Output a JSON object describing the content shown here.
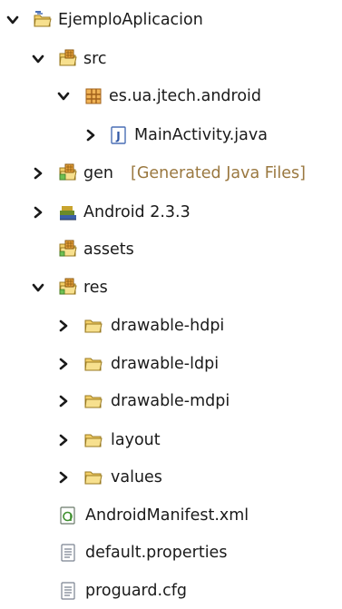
{
  "tree": {
    "project": "EjemploAplicacion",
    "src": "src",
    "package": "es.ua.jtech.android",
    "main_activity": "MainActivity.java",
    "gen": "gen",
    "gen_note": "[Generated Java Files]",
    "android": "Android 2.3.3",
    "assets": "assets",
    "res": "res",
    "drawable_hdpi": "drawable-hdpi",
    "drawable_ldpi": "drawable-ldpi",
    "drawable_mdpi": "drawable-mdpi",
    "layout": "layout",
    "values": "values",
    "manifest": "AndroidManifest.xml",
    "default_properties": "default.properties",
    "proguard": "proguard.cfg"
  }
}
